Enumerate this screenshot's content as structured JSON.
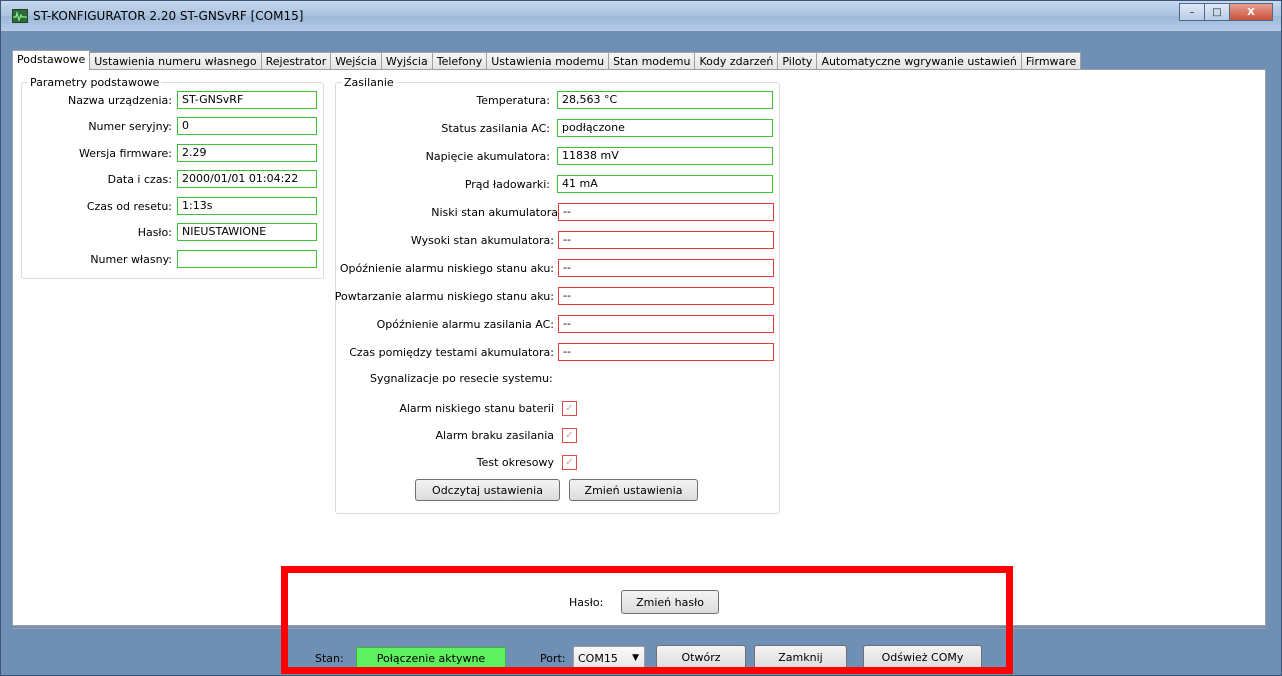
{
  "window": {
    "title": "ST-KONFIGURATOR 2.20 ST-GNSvRF  [COM15]",
    "minimize": "–",
    "maximize": "□",
    "close": "X"
  },
  "tabs": [
    "Podstawowe",
    "Ustawienia numeru własnego",
    "Rejestrator",
    "Wejścia",
    "Wyjścia",
    "Telefony",
    "Ustawienia modemu",
    "Stan modemu",
    "Kody zdarzeń",
    "Piloty",
    "Automatyczne wgrywanie ustawień",
    "Firmware"
  ],
  "basic": {
    "title": "Parametry podstawowe",
    "rows": [
      {
        "label": "Nazwa urządzenia:",
        "value": "ST-GNSvRF"
      },
      {
        "label": "Numer seryjny:",
        "value": "0"
      },
      {
        "label": "Wersja firmware:",
        "value": "2.29"
      },
      {
        "label": "Data i czas:",
        "value": "2000/01/01 01:04:22"
      },
      {
        "label": "Czas od resetu:",
        "value": "1:13s"
      },
      {
        "label": "Hasło:",
        "value": "NIEUSTAWIONE"
      },
      {
        "label": "Numer własny:",
        "value": ""
      }
    ]
  },
  "power": {
    "title": "Zasilanie",
    "rows": [
      {
        "label": "Temperatura:",
        "value": "28,563 °C"
      },
      {
        "label": "Status zasilania AC:",
        "value": "podłączone"
      },
      {
        "label": "Napięcie akumulatora:",
        "value": "11838 mV"
      },
      {
        "label": "Prąd ładowarki:",
        "value": "41 mA"
      },
      {
        "label": "Niski stan akumulatora",
        "value": "--"
      },
      {
        "label": "Wysoki stan akumulatora:",
        "value": "--"
      },
      {
        "label": "Opóźnienie alarmu niskiego stanu aku:",
        "value": "--"
      },
      {
        "label": "Powtarzanie alarmu niskiego stanu aku:",
        "value": "--"
      },
      {
        "label": "Opóźnienie alarmu zasilania AC:",
        "value": "--"
      },
      {
        "label": "Czas pomiędzy testami akumulatora:",
        "value": "--"
      }
    ],
    "signals_label": "Sygnalizacje po resecie systemu:",
    "checks": [
      {
        "label": "Alarm niskiego stanu baterii",
        "mark": "✓"
      },
      {
        "label": "Alarm braku zasilania",
        "mark": "✓"
      },
      {
        "label": "Test okresowy",
        "mark": "✓"
      }
    ],
    "read_button": "Odczytaj ustawienia",
    "change_button": "Zmień ustawienia"
  },
  "password": {
    "label": "Hasło:",
    "button": "Zmień hasło"
  },
  "status": {
    "label": "Stan:",
    "value": "Połączenie aktywne",
    "status_color": "#5ef05e",
    "port_label": "Port:",
    "port_value": "COM15",
    "open_button": "Otwórz",
    "close_button": "Zamknij",
    "refresh_button": "Odśwież COMy"
  },
  "highlight_color": "#ff0000"
}
